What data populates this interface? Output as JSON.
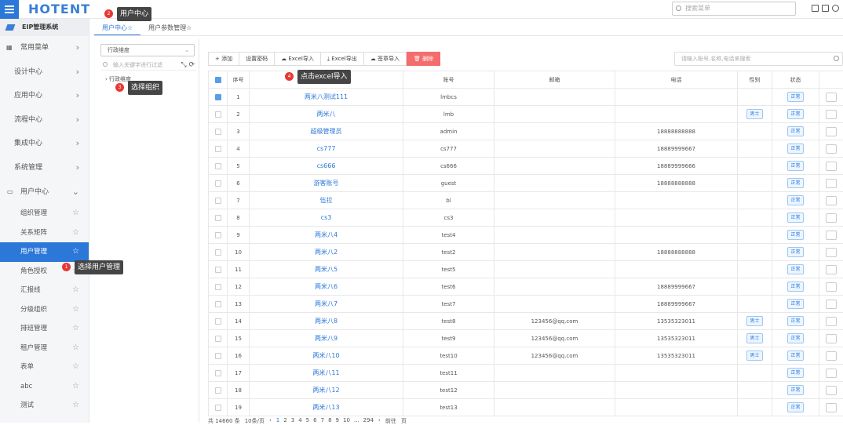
{
  "topbar": {
    "logo": "HOTENT",
    "search_placeholder": "搜索菜单"
  },
  "sidebar": {
    "system_name": "EIP管理系统",
    "items": [
      {
        "label": "常用菜单"
      },
      {
        "label": "设计中心"
      },
      {
        "label": "应用中心"
      },
      {
        "label": "流程中心"
      },
      {
        "label": "集成中心"
      },
      {
        "label": "系统管理"
      },
      {
        "label": "用户中心"
      }
    ],
    "sub_items": [
      "组织管理",
      "关系矩阵",
      "用户管理",
      "角色授权",
      "汇报线",
      "分级组织",
      "排班管理",
      "租户管理",
      "表单",
      "abc",
      "测试"
    ]
  },
  "tabs": [
    "用户中心",
    "用户参数管理"
  ],
  "org": {
    "dimension": "行政维度",
    "search_placeholder": "输入关键字进行过滤",
    "root": "行政维度"
  },
  "toolbar": {
    "add": "+ 添加",
    "set_pwd": "设置密码",
    "excel_import": "Excel导入",
    "excel_export": "Excel导出",
    "sign_import": "签章导入",
    "delete": "删除",
    "search_placeholder": "请输入账号,名称,电话来搜索"
  },
  "table": {
    "headers": [
      "序号",
      "姓名",
      "账号",
      "邮箱",
      "电话",
      "性别",
      "状态"
    ],
    "rows": [
      {
        "no": "1",
        "name": "两米八测试111",
        "account": "lmbcs",
        "email": "",
        "phone": "",
        "gender": "",
        "status": "正常",
        "checked": true
      },
      {
        "no": "2",
        "name": "两米八",
        "account": "lmb",
        "email": "",
        "phone": "",
        "gender": "男士",
        "status": "正常",
        "checked": false
      },
      {
        "no": "3",
        "name": "超级管理员",
        "account": "admin",
        "email": "",
        "phone": "18888888888",
        "gender": "",
        "status": "正常",
        "checked": false
      },
      {
        "no": "4",
        "name": "cs777",
        "account": "cs777",
        "email": "",
        "phone": "18889999667",
        "gender": "",
        "status": "正常",
        "checked": false
      },
      {
        "no": "5",
        "name": "cs666",
        "account": "cs666",
        "email": "",
        "phone": "18889999666",
        "gender": "",
        "status": "正常",
        "checked": false
      },
      {
        "no": "6",
        "name": "游客账号",
        "account": "guest",
        "email": "",
        "phone": "18888888888",
        "gender": "",
        "status": "正常",
        "checked": false
      },
      {
        "no": "7",
        "name": "伍拉",
        "account": "bl",
        "email": "",
        "phone": "",
        "gender": "",
        "status": "正常",
        "checked": false
      },
      {
        "no": "8",
        "name": "cs3",
        "account": "cs3",
        "email": "",
        "phone": "",
        "gender": "",
        "status": "正常",
        "checked": false
      },
      {
        "no": "9",
        "name": "两米八4",
        "account": "test4",
        "email": "",
        "phone": "",
        "gender": "",
        "status": "正常",
        "checked": false
      },
      {
        "no": "10",
        "name": "两米八2",
        "account": "test2",
        "email": "",
        "phone": "18888888888",
        "gender": "",
        "status": "正常",
        "checked": false
      },
      {
        "no": "11",
        "name": "两米八5",
        "account": "test5",
        "email": "",
        "phone": "",
        "gender": "",
        "status": "正常",
        "checked": false
      },
      {
        "no": "12",
        "name": "两米八6",
        "account": "test6",
        "email": "",
        "phone": "18889999667",
        "gender": "",
        "status": "正常",
        "checked": false
      },
      {
        "no": "13",
        "name": "两米八7",
        "account": "test7",
        "email": "",
        "phone": "18889999667",
        "gender": "",
        "status": "正常",
        "checked": false
      },
      {
        "no": "14",
        "name": "两米八8",
        "account": "test8",
        "email": "123456@qq.com",
        "phone": "13535323011",
        "gender": "男士",
        "status": "正常",
        "checked": false
      },
      {
        "no": "15",
        "name": "两米八9",
        "account": "test9",
        "email": "123456@qq.com",
        "phone": "13535323011",
        "gender": "男士",
        "status": "正常",
        "checked": false
      },
      {
        "no": "16",
        "name": "两米八10",
        "account": "test10",
        "email": "123456@qq.com",
        "phone": "13535323011",
        "gender": "男士",
        "status": "正常",
        "checked": false
      },
      {
        "no": "17",
        "name": "两米八11",
        "account": "test11",
        "email": "",
        "phone": "",
        "gender": "",
        "status": "正常",
        "checked": false
      },
      {
        "no": "18",
        "name": "两米八12",
        "account": "test12",
        "email": "",
        "phone": "",
        "gender": "",
        "status": "正常",
        "checked": false
      },
      {
        "no": "19",
        "name": "两米八13",
        "account": "test13",
        "email": "",
        "phone": "",
        "gender": "",
        "status": "正常",
        "checked": false
      }
    ]
  },
  "callouts": {
    "c1": {
      "num": "1",
      "text": "选择用户管理"
    },
    "c2": {
      "num": "2",
      "text": "用户中心"
    },
    "c3": {
      "num": "3",
      "text": "选择组织"
    },
    "c4": {
      "num": "4",
      "text": "点击excel导入"
    }
  },
  "pager": {
    "total": "共 14660 条",
    "size": "10条/页",
    "pages": [
      "1",
      "2",
      "3",
      "4",
      "5",
      "6",
      "7",
      "8",
      "9",
      "10",
      "...",
      "294"
    ],
    "goto": "前往",
    "page_unit": "页"
  },
  "colors": {
    "accent": "#2b78d8",
    "danger": "#f56c6c"
  }
}
